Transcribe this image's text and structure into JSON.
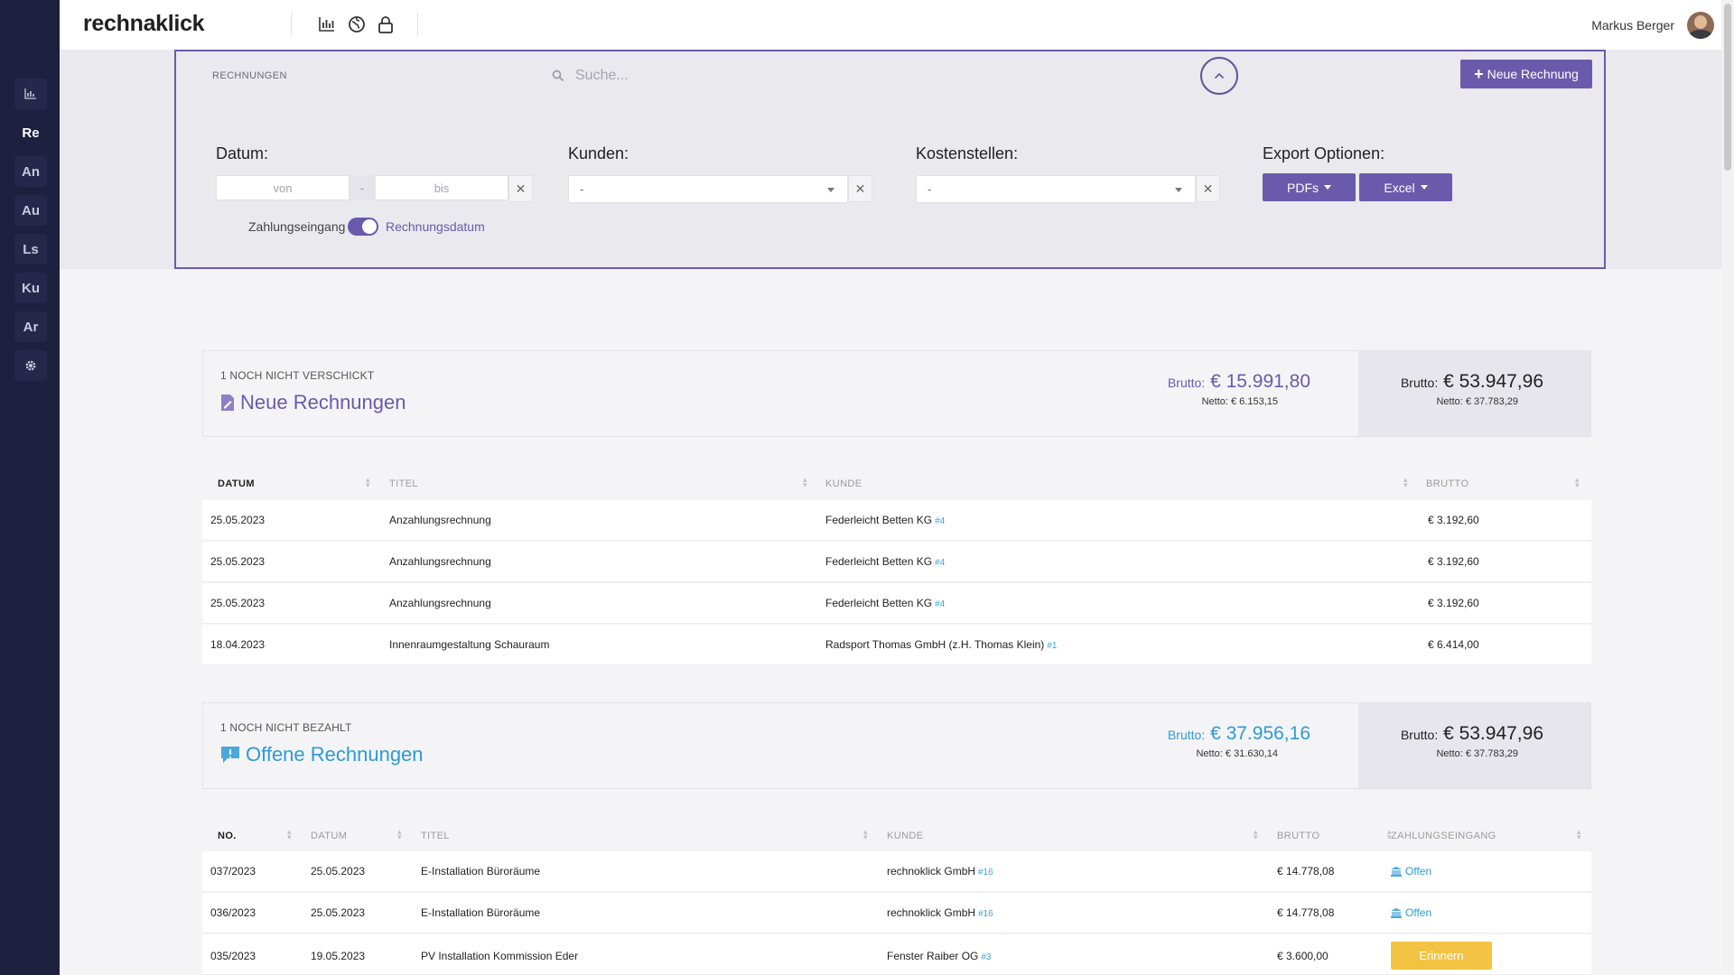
{
  "app": {
    "logo": "rechnaklick",
    "user_name": "Markus Berger"
  },
  "sidebar": {
    "items": [
      {
        "label": "",
        "icon": "chart-icon"
      },
      {
        "label": "Re",
        "active": true
      },
      {
        "label": "An"
      },
      {
        "label": "Au"
      },
      {
        "label": "Ls"
      },
      {
        "label": "Ku"
      },
      {
        "label": "Ar"
      },
      {
        "label": "",
        "icon": "gear-icon"
      }
    ]
  },
  "filter": {
    "title": "RECHNUNGEN",
    "search_placeholder": "Suche...",
    "new_button": "Neue Rechnung",
    "date_label": "Datum:",
    "date_from_placeholder": "von",
    "date_sep": "-",
    "date_to_placeholder": "bis",
    "customers_label": "Kunden:",
    "customers_value": "-",
    "costcenters_label": "Kostenstellen:",
    "costcenters_value": "-",
    "export_label": "Export Optionen:",
    "export_pdfs": "PDFs",
    "export_excel": "Excel",
    "toggle_left": "Zahlungseingang",
    "toggle_right": "Rechnungsdatum",
    "clear_symbol": "✕"
  },
  "new_invoices": {
    "eyebrow": "1 NOCH NICHT VERSCHICKT",
    "title": "Neue Rechnungen",
    "brutto_label": "Brutto:",
    "brutto": "€ 15.991,80",
    "netto_label": "Netto:",
    "netto": "€ 6.153,15",
    "total_brutto": "€ 53.947,96",
    "total_netto": "€ 37.783,29",
    "columns": [
      "DATUM",
      "TITEL",
      "KUNDE",
      "BRUTTO"
    ],
    "rows": [
      {
        "date": "25.05.2023",
        "title": "Anzahlungsrechnung",
        "customer": "Federleicht Betten KG",
        "ref": "#4",
        "brutto": "€ 3.192,60"
      },
      {
        "date": "25.05.2023",
        "title": "Anzahlungsrechnung",
        "customer": "Federleicht Betten KG",
        "ref": "#4",
        "brutto": "€ 3.192,60"
      },
      {
        "date": "25.05.2023",
        "title": "Anzahlungsrechnung",
        "customer": "Federleicht Betten KG",
        "ref": "#4",
        "brutto": "€ 3.192,60"
      },
      {
        "date": "18.04.2023",
        "title": "Innenraumgestaltung Schauraum",
        "customer": "Radsport Thomas GmbH (z.H. Thomas Klein)",
        "ref": "#1",
        "brutto": "€ 6.414,00"
      }
    ]
  },
  "open_invoices": {
    "eyebrow": "1 NOCH NICHT BEZAHLT",
    "title": "Offene Rechnungen",
    "brutto_label": "Brutto:",
    "brutto": "€ 37.956,16",
    "netto_label": "Netto:",
    "netto": "€ 31.630,14",
    "total_brutto": "€ 53.947,96",
    "total_netto": "€ 37.783,29",
    "columns": [
      "NO.",
      "DATUM",
      "TITEL",
      "KUNDE",
      "BRUTTO",
      "ZAHLUNGSEINGANG"
    ],
    "rows": [
      {
        "no": "037/2023",
        "date": "25.05.2023",
        "title": "E-Installation Büroräume",
        "customer": "rechnoklick GmbH",
        "ref": "#16",
        "brutto": "€ 14.778,08",
        "status": "Offen"
      },
      {
        "no": "036/2023",
        "date": "25.05.2023",
        "title": "E-Installation Büroräume",
        "customer": "rechnoklick GmbH",
        "ref": "#16",
        "brutto": "€ 14.778,08",
        "status": "Offen"
      },
      {
        "no": "035/2023",
        "date": "19.05.2023",
        "title": "PV Installation Kommission Eder",
        "customer": "Fenster Raiber OG",
        "ref": "#3",
        "brutto": "€ 3.600,00",
        "action": "Erinnern"
      }
    ]
  },
  "colors": {
    "primary": "#6a5aab",
    "info": "#2d9ad4",
    "warning": "#f2c342",
    "sidebar": "#1e2040"
  }
}
